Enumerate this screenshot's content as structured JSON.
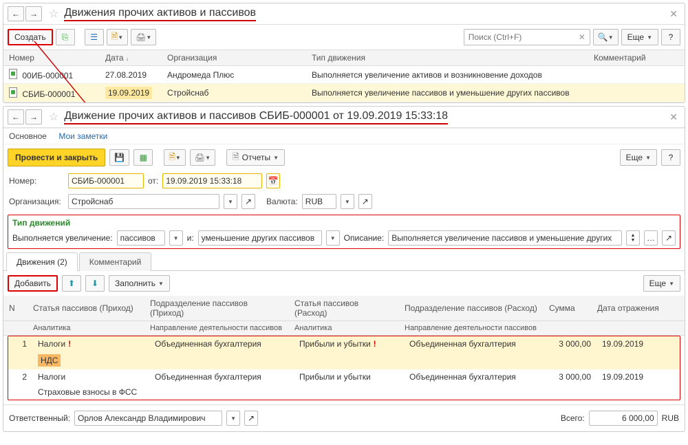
{
  "top": {
    "title": "Движения прочих активов и пассивов",
    "create_btn": "Создать",
    "search_placeholder": "Поиск (Ctrl+F)",
    "more_btn": "Еще",
    "cols": {
      "number": "Номер",
      "date": "Дата",
      "org": "Организация",
      "move_type": "Тип движения",
      "comment": "Комментарий"
    },
    "rows": [
      {
        "num": "00ИБ-000001",
        "date": "27.08.2019",
        "org": "Андромеда Плюс",
        "type": "Выполняется увеличение активов и возникновение доходов"
      },
      {
        "num": "СБИБ-000001",
        "date": "19.09.2019",
        "org": "Стройснаб",
        "type": "Выполняется увеличение пассивов и уменьшение других пассивов"
      }
    ]
  },
  "doc": {
    "title": "Движение прочих активов и пассивов СБИБ-000001 от 19.09.2019 15:33:18",
    "tab_main": "Основное",
    "tab_notes": "Мои заметки",
    "post_close": "Провести и закрыть",
    "reports_btn": "Отчеты",
    "more_btn": "Еще",
    "number_lbl": "Номер:",
    "number_val": "СБИБ-000001",
    "from_lbl": "от:",
    "date_val": "19.09.2019 15:33:18",
    "org_lbl": "Организация:",
    "org_val": "Стройснаб",
    "currency_lbl": "Валюта:",
    "currency_val": "RUB",
    "mtype": {
      "title": "Тип движений",
      "inc_lbl": "Выполняется увеличение:",
      "inc_val": "пассивов",
      "and_lbl": "и:",
      "dec_val": "уменьшение других пассивов",
      "desc_lbl": "Описание:",
      "desc_val": "Выполняется увеличение пассивов и уменьшение других"
    },
    "tab_moves": "Движения (2)",
    "tab_comment": "Комментарий",
    "add_btn": "Добавить",
    "fill_btn": "Заполнить",
    "mov_cols": {
      "n": "N",
      "item_in": "Статья пассивов (Приход)",
      "unit_in": "Подразделение пассивов (Приход)",
      "item_out": "Статья пассивов (Расход)",
      "unit_out": "Подразделение пассивов (Расход)",
      "sum": "Сумма",
      "date": "Дата отражения",
      "analytic": "Аналитика",
      "direction": "Направление деятельности пассивов"
    },
    "mov_rows": [
      {
        "n": "1",
        "item_in": "Налоги",
        "unit_in": "Объединенная бухгалтерия",
        "item_out": "Прибыли и убытки",
        "unit_out": "Объединенная бухгалтерия",
        "sum": "3 000,00",
        "date": "19.09.2019",
        "analytic": "НДС",
        "excl": true
      },
      {
        "n": "2",
        "item_in": "Налоги",
        "unit_in": "Объединенная бухгалтерия",
        "item_out": "Прибыли и убытки",
        "unit_out": "Объединенная бухгалтерия",
        "sum": "3 000,00",
        "date": "19.09.2019",
        "analytic": "Страховые взносы в ФСС",
        "excl": false
      }
    ],
    "resp_lbl": "Ответственный:",
    "resp_val": "Орлов Александр Владимирович",
    "total_lbl": "Всего:",
    "total_val": "6 000,00",
    "total_cur": "RUB"
  }
}
